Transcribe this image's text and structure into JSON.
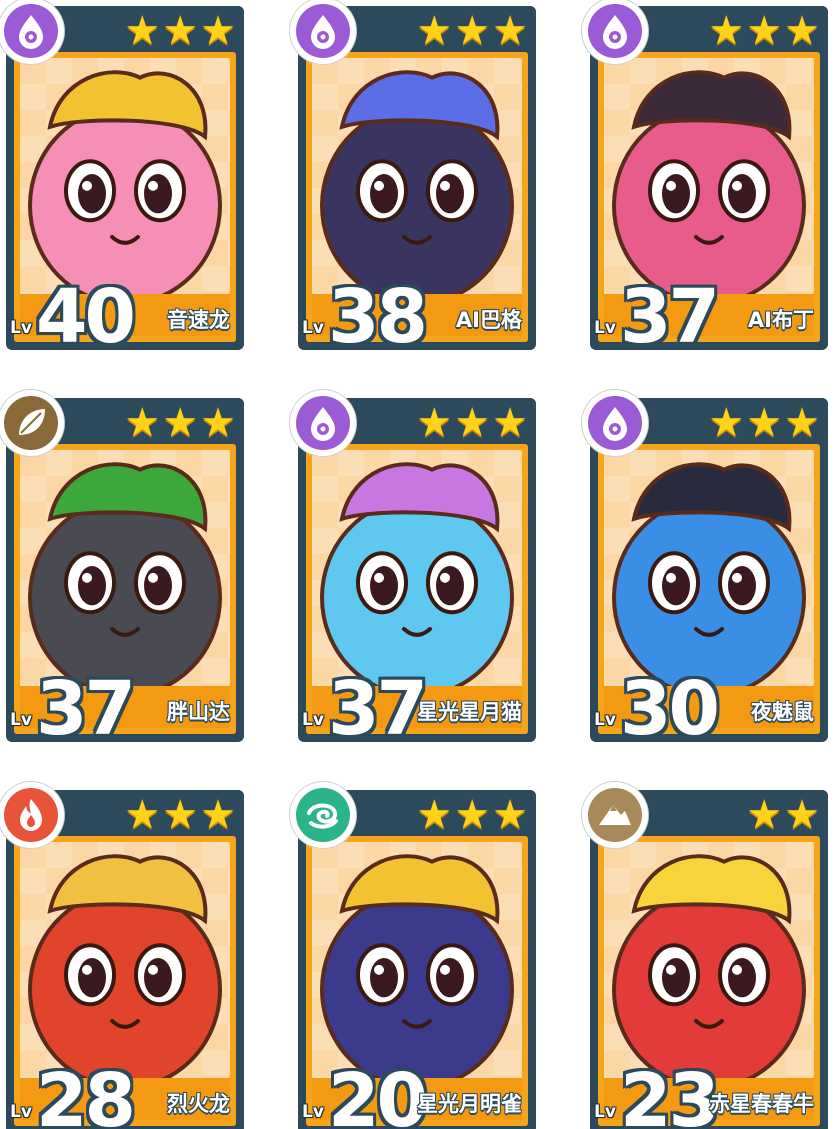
{
  "level_prefix": "Lv",
  "cards": [
    {
      "level": "40",
      "name": "音速龙",
      "stars": 3,
      "element_icon": "eye-icon",
      "element_color": "#9b5bd6",
      "body_color": "#f58fb5",
      "accent_color": "#f2c230"
    },
    {
      "level": "38",
      "name": "AI巴格",
      "stars": 3,
      "element_icon": "eye-icon",
      "element_color": "#9b5bd6",
      "body_color": "#3a3560",
      "accent_color": "#5b6ee8"
    },
    {
      "level": "37",
      "name": "AI布丁",
      "stars": 3,
      "element_icon": "eye-icon",
      "element_color": "#9b5bd6",
      "body_color": "#e85c8c",
      "accent_color": "#3a2a3a"
    },
    {
      "level": "37",
      "name": "胖山达",
      "stars": 3,
      "element_icon": "leaf-icon",
      "element_color": "#8b6a3a",
      "body_color": "#4a4a52",
      "accent_color": "#3ca83c"
    },
    {
      "level": "37",
      "name": "星光星月猫",
      "stars": 3,
      "element_icon": "eye-icon",
      "element_color": "#9b5bd6",
      "body_color": "#5ec8f0",
      "accent_color": "#c877e0"
    },
    {
      "level": "30",
      "name": "夜魅鼠",
      "stars": 3,
      "element_icon": "eye-icon",
      "element_color": "#9b5bd6",
      "body_color": "#3a8ee6",
      "accent_color": "#2a2a3e"
    },
    {
      "level": "28",
      "name": "烈火龙",
      "stars": 3,
      "element_icon": "fire-icon",
      "element_color": "#e8543a",
      "body_color": "#e0452c",
      "accent_color": "#f2c040"
    },
    {
      "level": "20",
      "name": "星光月明雀",
      "stars": 3,
      "element_icon": "wind-icon",
      "element_color": "#2bb38a",
      "body_color": "#3b3a8c",
      "accent_color": "#f2c230"
    },
    {
      "level": "23",
      "name": "赤星春春牛",
      "stars": 2,
      "element_icon": "mountain-icon",
      "element_color": "#a88a5a",
      "body_color": "#e33a3a",
      "accent_color": "#f6d43a"
    }
  ]
}
